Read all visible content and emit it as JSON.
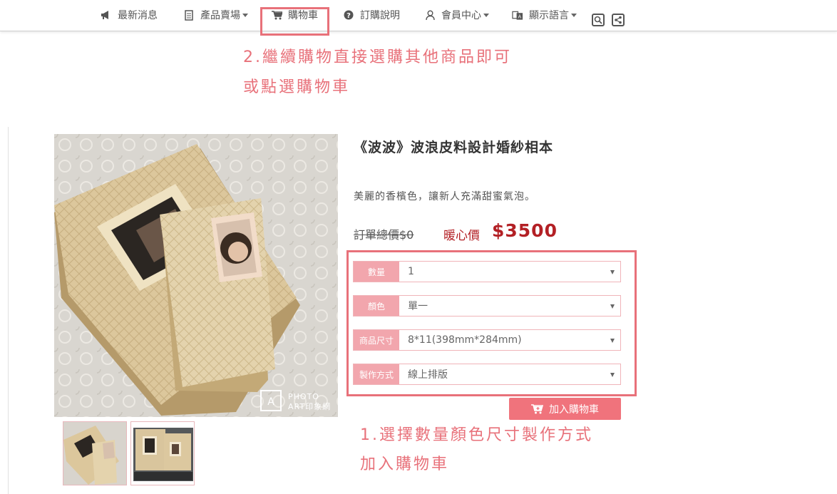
{
  "nav": {
    "items": [
      {
        "label": "最新消息",
        "icon": "megaphone-icon"
      },
      {
        "label": "產品賣場",
        "icon": "document-icon",
        "dropdown": true
      },
      {
        "label": "購物車",
        "icon": "cart-icon"
      },
      {
        "label": "訂購說明",
        "icon": "question-circle-icon"
      },
      {
        "label": "會員中心",
        "icon": "user-icon",
        "dropdown": true
      },
      {
        "label": "顯示語言",
        "icon": "language-icon",
        "dropdown": true
      }
    ]
  },
  "annotations": {
    "step2_line1": "2.繼續購物直接選購其他商品即可",
    "step2_line2": "或點選購物車",
    "step1_line1": "1.選擇數量顏色尺寸製作方式",
    "step1_line2": "加入購物車",
    "color": "#e8717a"
  },
  "product": {
    "title": "《波波》波浪皮料設計婚紗相本",
    "description": "美麗的香檳色，讓新人充滿甜蜜氣泡。",
    "original_price": "訂單總價$0",
    "sale_label": "暖心價",
    "sale_price": "$3500",
    "watermark_line1": "PHOTO",
    "watermark_line2": "ART印象網"
  },
  "options": [
    {
      "label": "數量",
      "value": "1"
    },
    {
      "label": "顏色",
      "value": "單一"
    },
    {
      "label": "商品尺寸",
      "value": "8*11(398mm*284mm)"
    },
    {
      "label": "製作方式",
      "value": "線上排版"
    }
  ],
  "add_to_cart": {
    "label": "加入購物車"
  },
  "colors": {
    "accent": "#f0737c",
    "price": "#b32025",
    "label_bg": "#f2a6ad"
  }
}
